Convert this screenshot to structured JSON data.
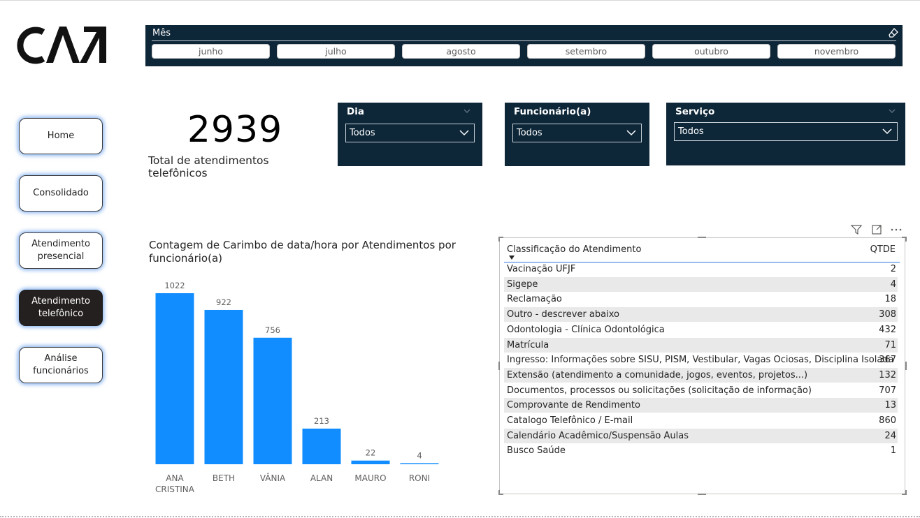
{
  "logo_text": "CA7",
  "month_slicer": {
    "title": "Mês",
    "options": [
      "junho",
      "julho",
      "agosto",
      "setembro",
      "outubro",
      "novembro"
    ]
  },
  "nav": {
    "items": [
      {
        "label": "Home",
        "active": false
      },
      {
        "label": "Consolidado",
        "active": false
      },
      {
        "label": "Atendimento presencial",
        "active": false
      },
      {
        "label": "Atendimento telefônico",
        "active": true
      },
      {
        "label": "Análise funcionários",
        "active": false
      }
    ]
  },
  "kpi": {
    "value": "2939",
    "label": "Total de atendimentos telefônicos"
  },
  "slicers": {
    "dia": {
      "title": "Dia",
      "value": "Todos"
    },
    "funcionario": {
      "title": "Funcionário(a)",
      "value": "Todos"
    },
    "servico": {
      "title": "Serviço",
      "value": "Todos"
    }
  },
  "colors": {
    "bar": "#118dff",
    "slicer_bg": "#0d2638",
    "nav_glow": "#2878e6",
    "row_alt": "#e9e9e9"
  },
  "chart_data": {
    "type": "bar",
    "title": "Contagem de Carimbo de data/hora por Atendimentos por funcionário(a)",
    "categories": [
      "ANA CRISTINA",
      "BETH",
      "VÂNIA",
      "ALAN",
      "MAURO",
      "RONI"
    ],
    "category_lines": [
      [
        "ANA",
        "CRISTINA"
      ],
      [
        "BETH"
      ],
      [
        "VÂNIA"
      ],
      [
        "ALAN"
      ],
      [
        "MAURO"
      ],
      [
        "RONI"
      ]
    ],
    "values": [
      1022,
      922,
      756,
      213,
      22,
      4
    ],
    "data_labels": true,
    "grid": false
  },
  "table": {
    "headers": [
      "Classificação do Atendimento",
      "QTDE"
    ],
    "rows": [
      {
        "name": "Vacinação UFJF",
        "qtde": "2"
      },
      {
        "name": "Sigepe",
        "qtde": "4"
      },
      {
        "name": "Reclamação",
        "qtde": "18"
      },
      {
        "name": "Outro - descrever abaixo",
        "qtde": "308"
      },
      {
        "name": "Odontologia - Clínica Odontológica",
        "qtde": "432"
      },
      {
        "name": "Matrícula",
        "qtde": "71"
      },
      {
        "name": "Ingresso: Informações sobre SISU, PISM, Vestibular, Vagas Ociosas, Disciplina Isolada",
        "qtde": "367"
      },
      {
        "name": "Extensão (atendimento a comunidade, jogos, eventos, projetos...)",
        "qtde": "132"
      },
      {
        "name": "Documentos, processos ou solicitações (solicitação de informação)",
        "qtde": "707"
      },
      {
        "name": "Comprovante de Rendimento",
        "qtde": "13"
      },
      {
        "name": "Catalogo Telefônico / E-mail",
        "qtde": "860"
      },
      {
        "name": "Calendário Acadêmico/Suspensão Aulas",
        "qtde": "24"
      },
      {
        "name": "Busco Saúde",
        "qtde": "1"
      }
    ]
  }
}
